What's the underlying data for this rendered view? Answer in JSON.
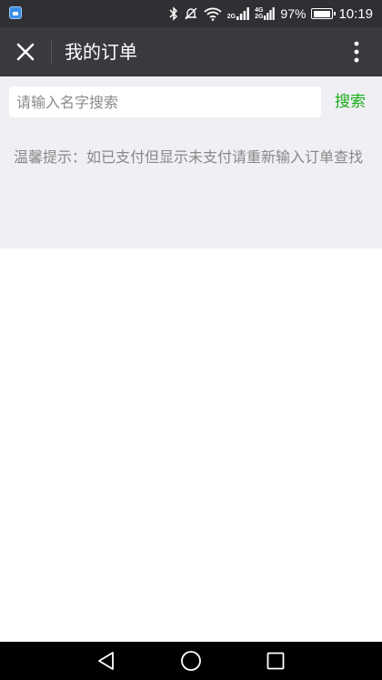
{
  "status_bar": {
    "battery_text": "97%",
    "time": "10:19",
    "network_top": "4G",
    "network_bottom": "2G",
    "signal_label": "2G",
    "battery_level": 0.97
  },
  "title_bar": {
    "title": "我的订单"
  },
  "search": {
    "placeholder": "请输入名字搜索",
    "value": "",
    "button_label": "搜索"
  },
  "tip": {
    "text": "温馨提示：如已支付但显示未支付请重新输入订单查找"
  },
  "colors": {
    "title_bar_bg": "#393a3f",
    "accent_green": "#1aad19",
    "content_bg": "#efeff4"
  },
  "icons": {
    "close": "close-icon",
    "more": "more-vertical-icon",
    "back": "back-triangle-icon",
    "home": "home-circle-icon",
    "recents": "recents-square-icon"
  }
}
